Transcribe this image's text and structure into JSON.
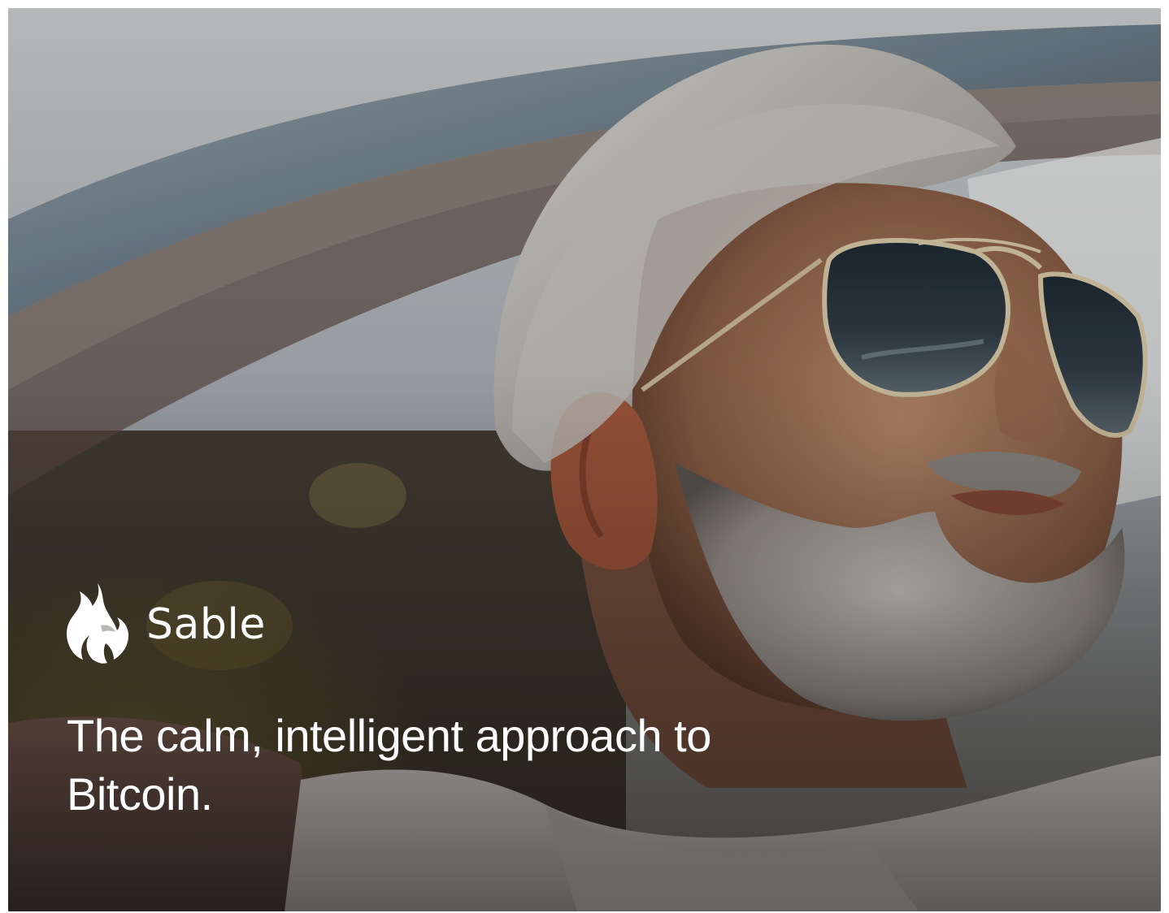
{
  "hero": {
    "image_alt": "Man with silver hair and beard wearing aviator sunglasses in a convertible",
    "brand_icon": "flame-bird-logo-icon",
    "brand_name": "Sable",
    "tagline": "The calm, intelligent approach to Bitcoin."
  },
  "colors": {
    "text": "#ffffff",
    "overlay": "#000000"
  }
}
